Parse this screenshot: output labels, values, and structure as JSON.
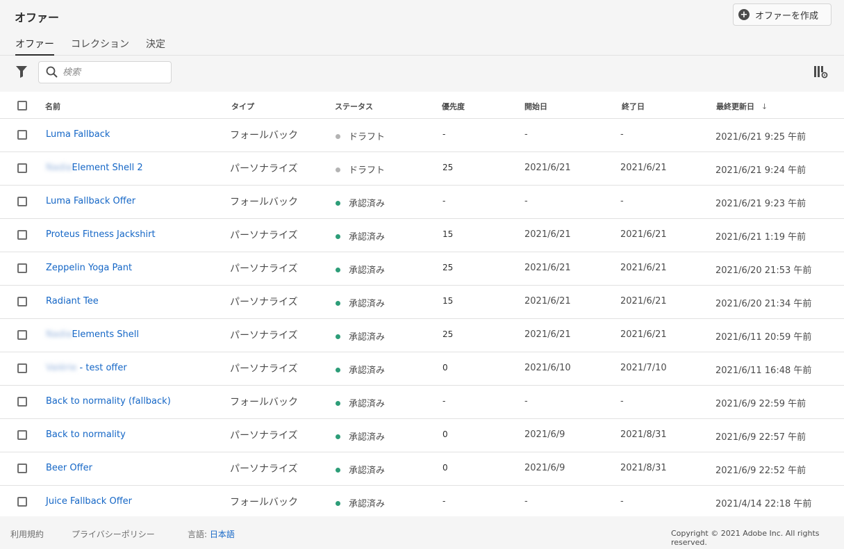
{
  "header": {
    "title": "オファー",
    "create_label": "オファーを作成"
  },
  "tabs": [
    {
      "label": "オファー",
      "active": true
    },
    {
      "label": "コレクション",
      "active": false
    },
    {
      "label": "決定",
      "active": false
    }
  ],
  "search": {
    "placeholder": "検索"
  },
  "columns": {
    "name": "名前",
    "type": "タイプ",
    "status": "ステータス",
    "priority": "優先度",
    "start": "開始日",
    "end": "終了日",
    "updated": "最終更新日",
    "sort_icon": "arrow-down-icon"
  },
  "status_colors": {
    "draft": "#b3b3b3",
    "approved": "#2d9d78"
  },
  "rows": [
    {
      "prefix": "",
      "name": "Luma Fallback",
      "type": "フォールバック",
      "status": "ドラフト",
      "status_kind": "draft",
      "priority": "-",
      "start": "-",
      "end": "-",
      "updated": "2021/6/21 9:25 午前"
    },
    {
      "prefix": "Nadia",
      "name": "Element Shell 2",
      "type": "パーソナライズ",
      "status": "ドラフト",
      "status_kind": "draft",
      "priority": "25",
      "start": "2021/6/21",
      "end": "2021/6/21",
      "updated": "2021/6/21 9:24 午前"
    },
    {
      "prefix": "",
      "name": "Luma Fallback Offer",
      "type": "フォールバック",
      "status": "承認済み",
      "status_kind": "approved",
      "priority": "-",
      "start": "-",
      "end": "-",
      "updated": "2021/6/21 9:23 午前"
    },
    {
      "prefix": "",
      "name": "Proteus Fitness Jackshirt",
      "type": "パーソナライズ",
      "status": "承認済み",
      "status_kind": "approved",
      "priority": "15",
      "start": "2021/6/21",
      "end": "2021/6/21",
      "updated": "2021/6/21 1:19 午前"
    },
    {
      "prefix": "",
      "name": "Zeppelin Yoga Pant",
      "type": "パーソナライズ",
      "status": "承認済み",
      "status_kind": "approved",
      "priority": "25",
      "start": "2021/6/21",
      "end": "2021/6/21",
      "updated": "2021/6/20 21:53 午前"
    },
    {
      "prefix": "",
      "name": "Radiant Tee",
      "type": "パーソナライズ",
      "status": "承認済み",
      "status_kind": "approved",
      "priority": "15",
      "start": "2021/6/21",
      "end": "2021/6/21",
      "updated": "2021/6/20 21:34 午前"
    },
    {
      "prefix": "Nadia",
      "name": "Elements Shell",
      "type": "パーソナライズ",
      "status": "承認済み",
      "status_kind": "approved",
      "priority": "25",
      "start": "2021/6/21",
      "end": "2021/6/21",
      "updated": "2021/6/11 20:59 午前"
    },
    {
      "prefix": "Valérie",
      "name": " - test offer",
      "type": "パーソナライズ",
      "status": "承認済み",
      "status_kind": "approved",
      "priority": "0",
      "start": "2021/6/10",
      "end": "2021/7/10",
      "updated": "2021/6/11 16:48 午前"
    },
    {
      "prefix": "",
      "name": "Back to normality (fallback)",
      "type": "フォールバック",
      "status": "承認済み",
      "status_kind": "approved",
      "priority": "-",
      "start": "-",
      "end": "-",
      "updated": "2021/6/9 22:59 午前"
    },
    {
      "prefix": "",
      "name": "Back to normality",
      "type": "パーソナライズ",
      "status": "承認済み",
      "status_kind": "approved",
      "priority": "0",
      "start": "2021/6/9",
      "end": "2021/8/31",
      "updated": "2021/6/9 22:57 午前"
    },
    {
      "prefix": "",
      "name": "Beer Offer",
      "type": "パーソナライズ",
      "status": "承認済み",
      "status_kind": "approved",
      "priority": "0",
      "start": "2021/6/9",
      "end": "2021/8/31",
      "updated": "2021/6/9 22:52 午前"
    },
    {
      "prefix": "",
      "name": "Juice Fallback Offer",
      "type": "フォールバック",
      "status": "承認済み",
      "status_kind": "approved",
      "priority": "-",
      "start": "-",
      "end": "-",
      "updated": "2021/4/14 22:18 午前"
    }
  ],
  "footer": {
    "terms": "利用規約",
    "privacy": "プライバシーポリシー",
    "language_label": "言語:",
    "language_value": "日本語",
    "copyright": "Copyright ©  2021 Adobe Inc.  All rights reserved."
  }
}
